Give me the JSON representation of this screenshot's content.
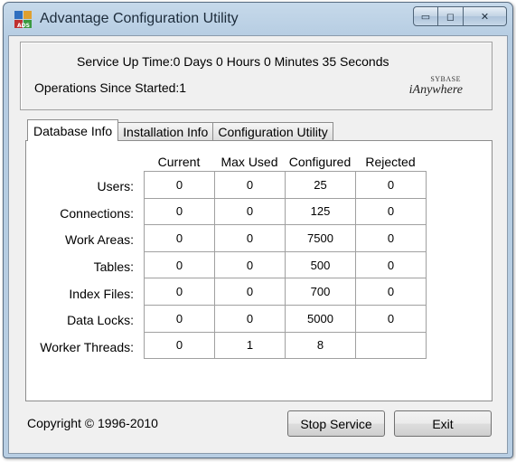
{
  "window": {
    "title": "Advantage Configuration Utility",
    "icon": "ads-app-icon",
    "caption": {
      "minimize_glyph": "▭",
      "maximize_glyph": "◻",
      "close_glyph": "✕"
    }
  },
  "status": {
    "uptime": "Service Up Time:0 Days 0 Hours 0 Minutes 35 Seconds",
    "operations": "Operations Since Started:1"
  },
  "logo": {
    "top": "SYBASE",
    "main": "iAnywhere"
  },
  "tabs": [
    {
      "label": "Database Info",
      "active": true
    },
    {
      "label": "Installation Info",
      "active": false
    },
    {
      "label": "Configuration Utility",
      "active": false
    }
  ],
  "table": {
    "columns": [
      "Current",
      "Max Used",
      "Configured",
      "Rejected"
    ],
    "rows": [
      {
        "label": "Users:",
        "values": [
          "0",
          "0",
          "25",
          "0"
        ]
      },
      {
        "label": "Connections:",
        "values": [
          "0",
          "0",
          "125",
          "0"
        ]
      },
      {
        "label": "Work Areas:",
        "values": [
          "0",
          "0",
          "7500",
          "0"
        ]
      },
      {
        "label": "Tables:",
        "values": [
          "0",
          "0",
          "500",
          "0"
        ]
      },
      {
        "label": "Index Files:",
        "values": [
          "0",
          "0",
          "700",
          "0"
        ]
      },
      {
        "label": "Data Locks:",
        "values": [
          "0",
          "0",
          "5000",
          "0"
        ]
      },
      {
        "label": "Worker Threads:",
        "values": [
          "0",
          "1",
          "8",
          ""
        ]
      }
    ]
  },
  "footer": {
    "copyright": "Copyright © 1996-2010",
    "stop_label": "Stop Service",
    "exit_label": "Exit"
  }
}
